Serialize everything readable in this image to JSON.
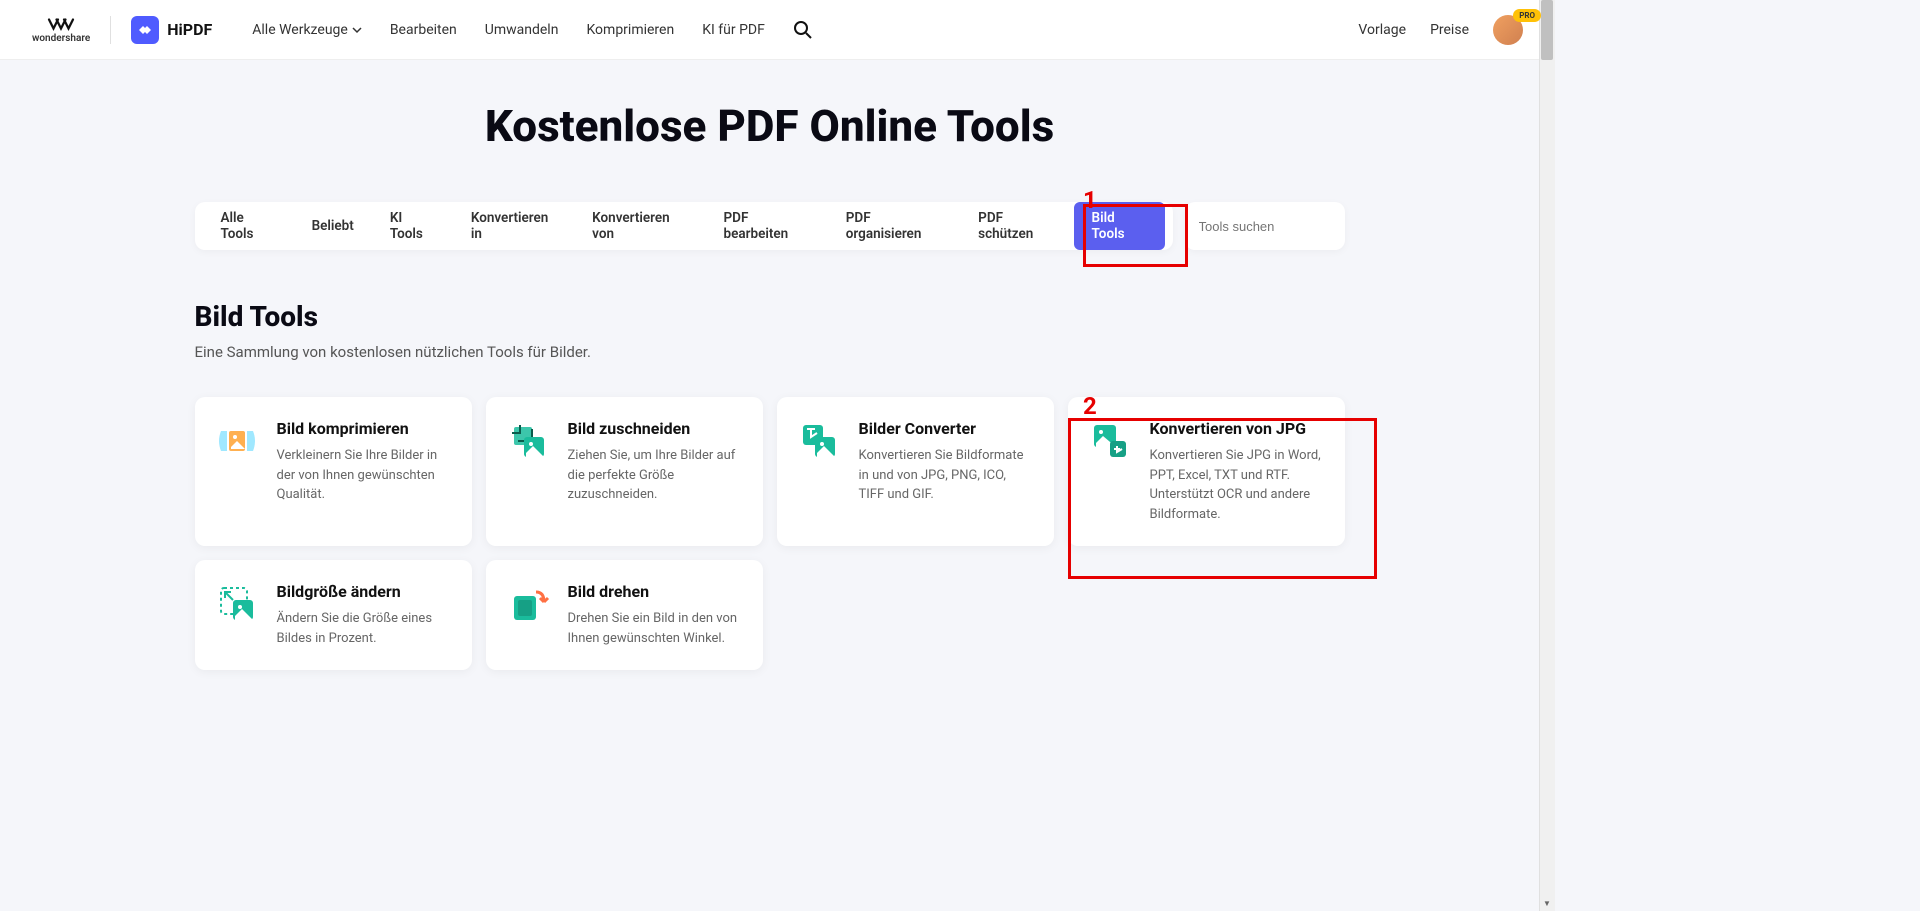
{
  "header": {
    "wondershare": "wondershare",
    "hipdf": "HiPDF",
    "nav": {
      "allTools": "Alle Werkzeuge",
      "edit": "Bearbeiten",
      "convert": "Umwandeln",
      "compress": "Komprimieren",
      "aiForPdf": "KI für PDF"
    },
    "right": {
      "template": "Vorlage",
      "pricing": "Preise",
      "proBadge": "PRO"
    }
  },
  "page": {
    "title": "Kostenlose PDF Online Tools"
  },
  "tabs": {
    "all": "Alle Tools",
    "popular": "Beliebt",
    "ai": "KI Tools",
    "convertTo": "Konvertieren in",
    "convertFrom": "Konvertieren von",
    "editPdf": "PDF bearbeiten",
    "organizePdf": "PDF organisieren",
    "protectPdf": "PDF schützen",
    "imageTools": "Bild Tools"
  },
  "search": {
    "placeholder": "Tools suchen"
  },
  "section": {
    "title": "Bild Tools",
    "desc": "Eine Sammlung von kostenlosen nützlichen Tools für Bilder."
  },
  "tools": {
    "compress": {
      "title": "Bild komprimieren",
      "desc": "Verkleinern Sie Ihre Bilder in der von Ihnen gewünschten Qualität."
    },
    "crop": {
      "title": "Bild zuschneiden",
      "desc": "Ziehen Sie, um Ihre Bilder auf die perfekte Größe zuzuschneiden."
    },
    "converter": {
      "title": "Bilder Converter",
      "desc": "Konvertieren Sie Bildformate in und von JPG, PNG, ICO, TIFF und GIF."
    },
    "convertJpg": {
      "title": "Konvertieren von JPG",
      "desc": "Konvertieren Sie JPG in Word, PPT, Excel, TXT und RTF. Unterstützt OCR und andere Bildformate."
    },
    "resize": {
      "title": "Bildgröße ändern",
      "desc": "Ändern Sie die Größe eines Bildes in Prozent."
    },
    "rotate": {
      "title": "Bild drehen",
      "desc": "Drehen Sie ein Bild in den von Ihnen gewünschten Winkel."
    }
  },
  "annotations": {
    "one": "1",
    "two": "2"
  }
}
